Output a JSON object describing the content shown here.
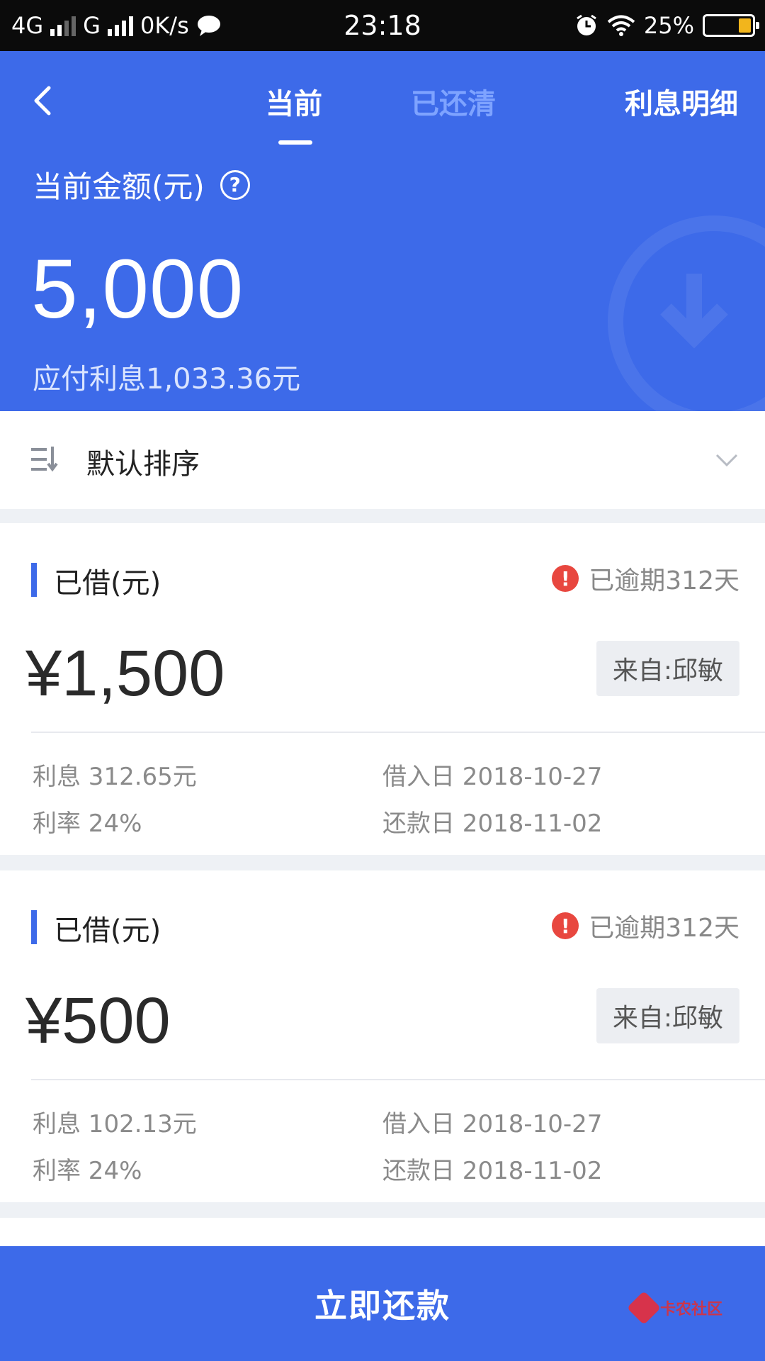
{
  "status_bar": {
    "network_1": "4G",
    "network_2": "G",
    "speed": "0K/s",
    "time": "23:18",
    "battery": "25%",
    "battery_level": 0.25
  },
  "header": {
    "tabs": [
      {
        "label": "当前",
        "active": true
      },
      {
        "label": "已还清",
        "active": false
      }
    ],
    "interest_detail": "利息明细",
    "amount_label": "当前金额(元)",
    "amount_value": "5,000",
    "interest_due": "应付利息1,033.36元",
    "accent_color": "#3d6ae9"
  },
  "sort": {
    "label": "默认排序"
  },
  "loans": [
    {
      "title": "已借(元)",
      "overdue": "已逾期312天",
      "amount": "¥1,500",
      "lender": "来自:邱敏",
      "interest": "利息 312.65元",
      "rate": "利率 24%",
      "borrow_date": "借入日 2018-10-27",
      "repay_date": "还款日 2018-11-02"
    },
    {
      "title": "已借(元)",
      "overdue": "已逾期312天",
      "amount": "¥500",
      "lender": "来自:邱敏",
      "interest": "利息 102.13元",
      "rate": "利率 24%",
      "borrow_date": "借入日 2018-10-27",
      "repay_date": "还款日 2018-11-02"
    }
  ],
  "footer": {
    "repay_button": "立即还款",
    "watermark": "卡农社区"
  },
  "icons": {
    "back": "back-arrow-icon",
    "help": "help-icon",
    "sort": "sort-icon",
    "chevron": "chevron-down-icon",
    "overdue": "warning-icon"
  }
}
